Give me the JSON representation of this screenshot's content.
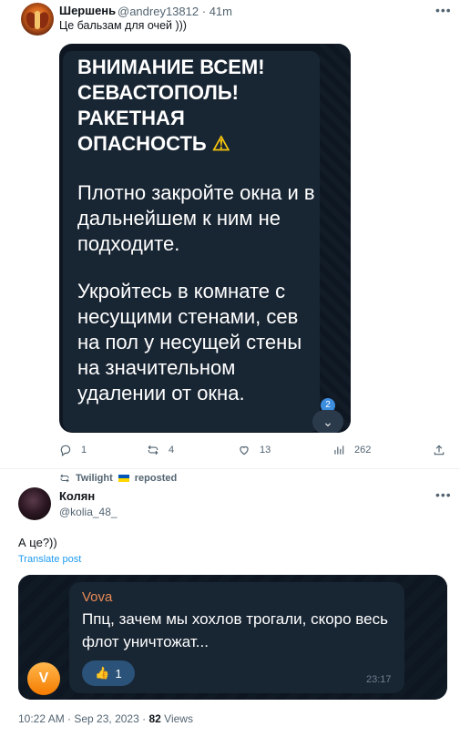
{
  "tweet1": {
    "name": "Шершень",
    "handle": "@andrey13812",
    "time": "41m",
    "text": "Це бальзам для очей )))",
    "image": {
      "heading": "ВНИМАНИЕ ВСЕМ! СЕВАСТОПОЛЬ! РАКЕТНАЯ ОПАСНОСТЬ",
      "warning_glyph": "⚠",
      "para1": "Плотно закройте окна и в дальнейшем к ним не подходите.",
      "para2": "Укройтесь в комнате с несущими стенами, сев на пол у несущей стены на значительном удалении от окна.",
      "badge": "2"
    },
    "replies": "1",
    "reposts": "4",
    "likes": "13",
    "views": "262"
  },
  "tweet2": {
    "repost_by": "Twilight",
    "repost_label": "reposted",
    "name": "Колян",
    "handle": "@kolia_48_",
    "text": "А це?))",
    "translate": "Translate post",
    "image": {
      "sender": "Vova",
      "message": "Ппц, зачем мы хохлов трогали, скоро весь флот уничтожат...",
      "reaction_emoji": "👍",
      "reaction_count": "1",
      "msg_time": "23:17",
      "avatar_letter": "V"
    },
    "timestamp": "10:22 AM · Sep 23, 2023",
    "views": "82",
    "views_label": "Views"
  },
  "colors": {
    "link": "#1d9bf0",
    "telegram_bg": "#0e1621",
    "bubble": "#182533"
  }
}
